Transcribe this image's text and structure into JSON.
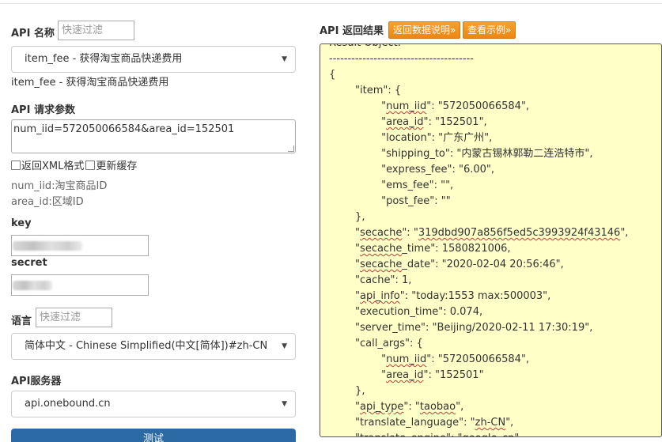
{
  "api_name": {
    "label": "API 名称",
    "filter_placeholder": "快速过滤",
    "selected": "item_fee - 获得淘宝商品快递费用",
    "description": "item_fee - 获得淘宝商品快递费用"
  },
  "request_params": {
    "label": "API 请求参数",
    "value": "num_iid=572050066584&area_id=152501",
    "xml_checkbox": "返回XML格式",
    "cache_checkbox": "更新缓存",
    "hints": [
      "num_iid:淘宝商品ID",
      "area_id:区域ID"
    ]
  },
  "key": {
    "label": "key"
  },
  "secret": {
    "label": "secret"
  },
  "language": {
    "label": "语言",
    "filter_placeholder": "快速过滤",
    "selected": "简体中文 - Chinese Simplified(中文[简体])#zh-CN"
  },
  "server": {
    "label": "API服务器",
    "selected": "api.onebound.cn"
  },
  "submit": {
    "label": "测试"
  },
  "result": {
    "label": "API 返回结果",
    "doc_button": "返回数据说明»",
    "example_button": "查看示例»",
    "lines": [
      "Result Object:",
      "---------------------------------------",
      "{",
      "        \"item\": {",
      "                \"num_iid\": \"572050066584\",",
      "                \"area_id\": \"152501\",",
      "                \"location\": \"广东广州\",",
      "                \"shipping_to\": \"内蒙古锡林郭勒二连浩特市\",",
      "                \"express_fee\": \"6.00\",",
      "                \"ems_fee\": \"\",",
      "                \"post_fee\": \"\"",
      "        },",
      "        \"secache\": \"319dbd907a856f5ed5c3993924f43146\",",
      "        \"secache_time\": 1580821006,",
      "        \"secache_date\": \"2020-02-04 20:56:46\",",
      "        \"cache\": 1,",
      "        \"api_info\": \"today:1553 max:500003\",",
      "        \"execution_time\": 0.074,",
      "        \"server_time\": \"Beijing/2020-02-11 17:30:19\",",
      "        \"call_args\": {",
      "                \"num_iid\": \"572050066584\",",
      "                \"area_id\": \"152501\"",
      "        },",
      "        \"api_type\": \"taobao\",",
      "        \"translate_language\": \"zh-CN\",",
      "        \"translate_engine\": \"google_cn\","
    ]
  }
}
